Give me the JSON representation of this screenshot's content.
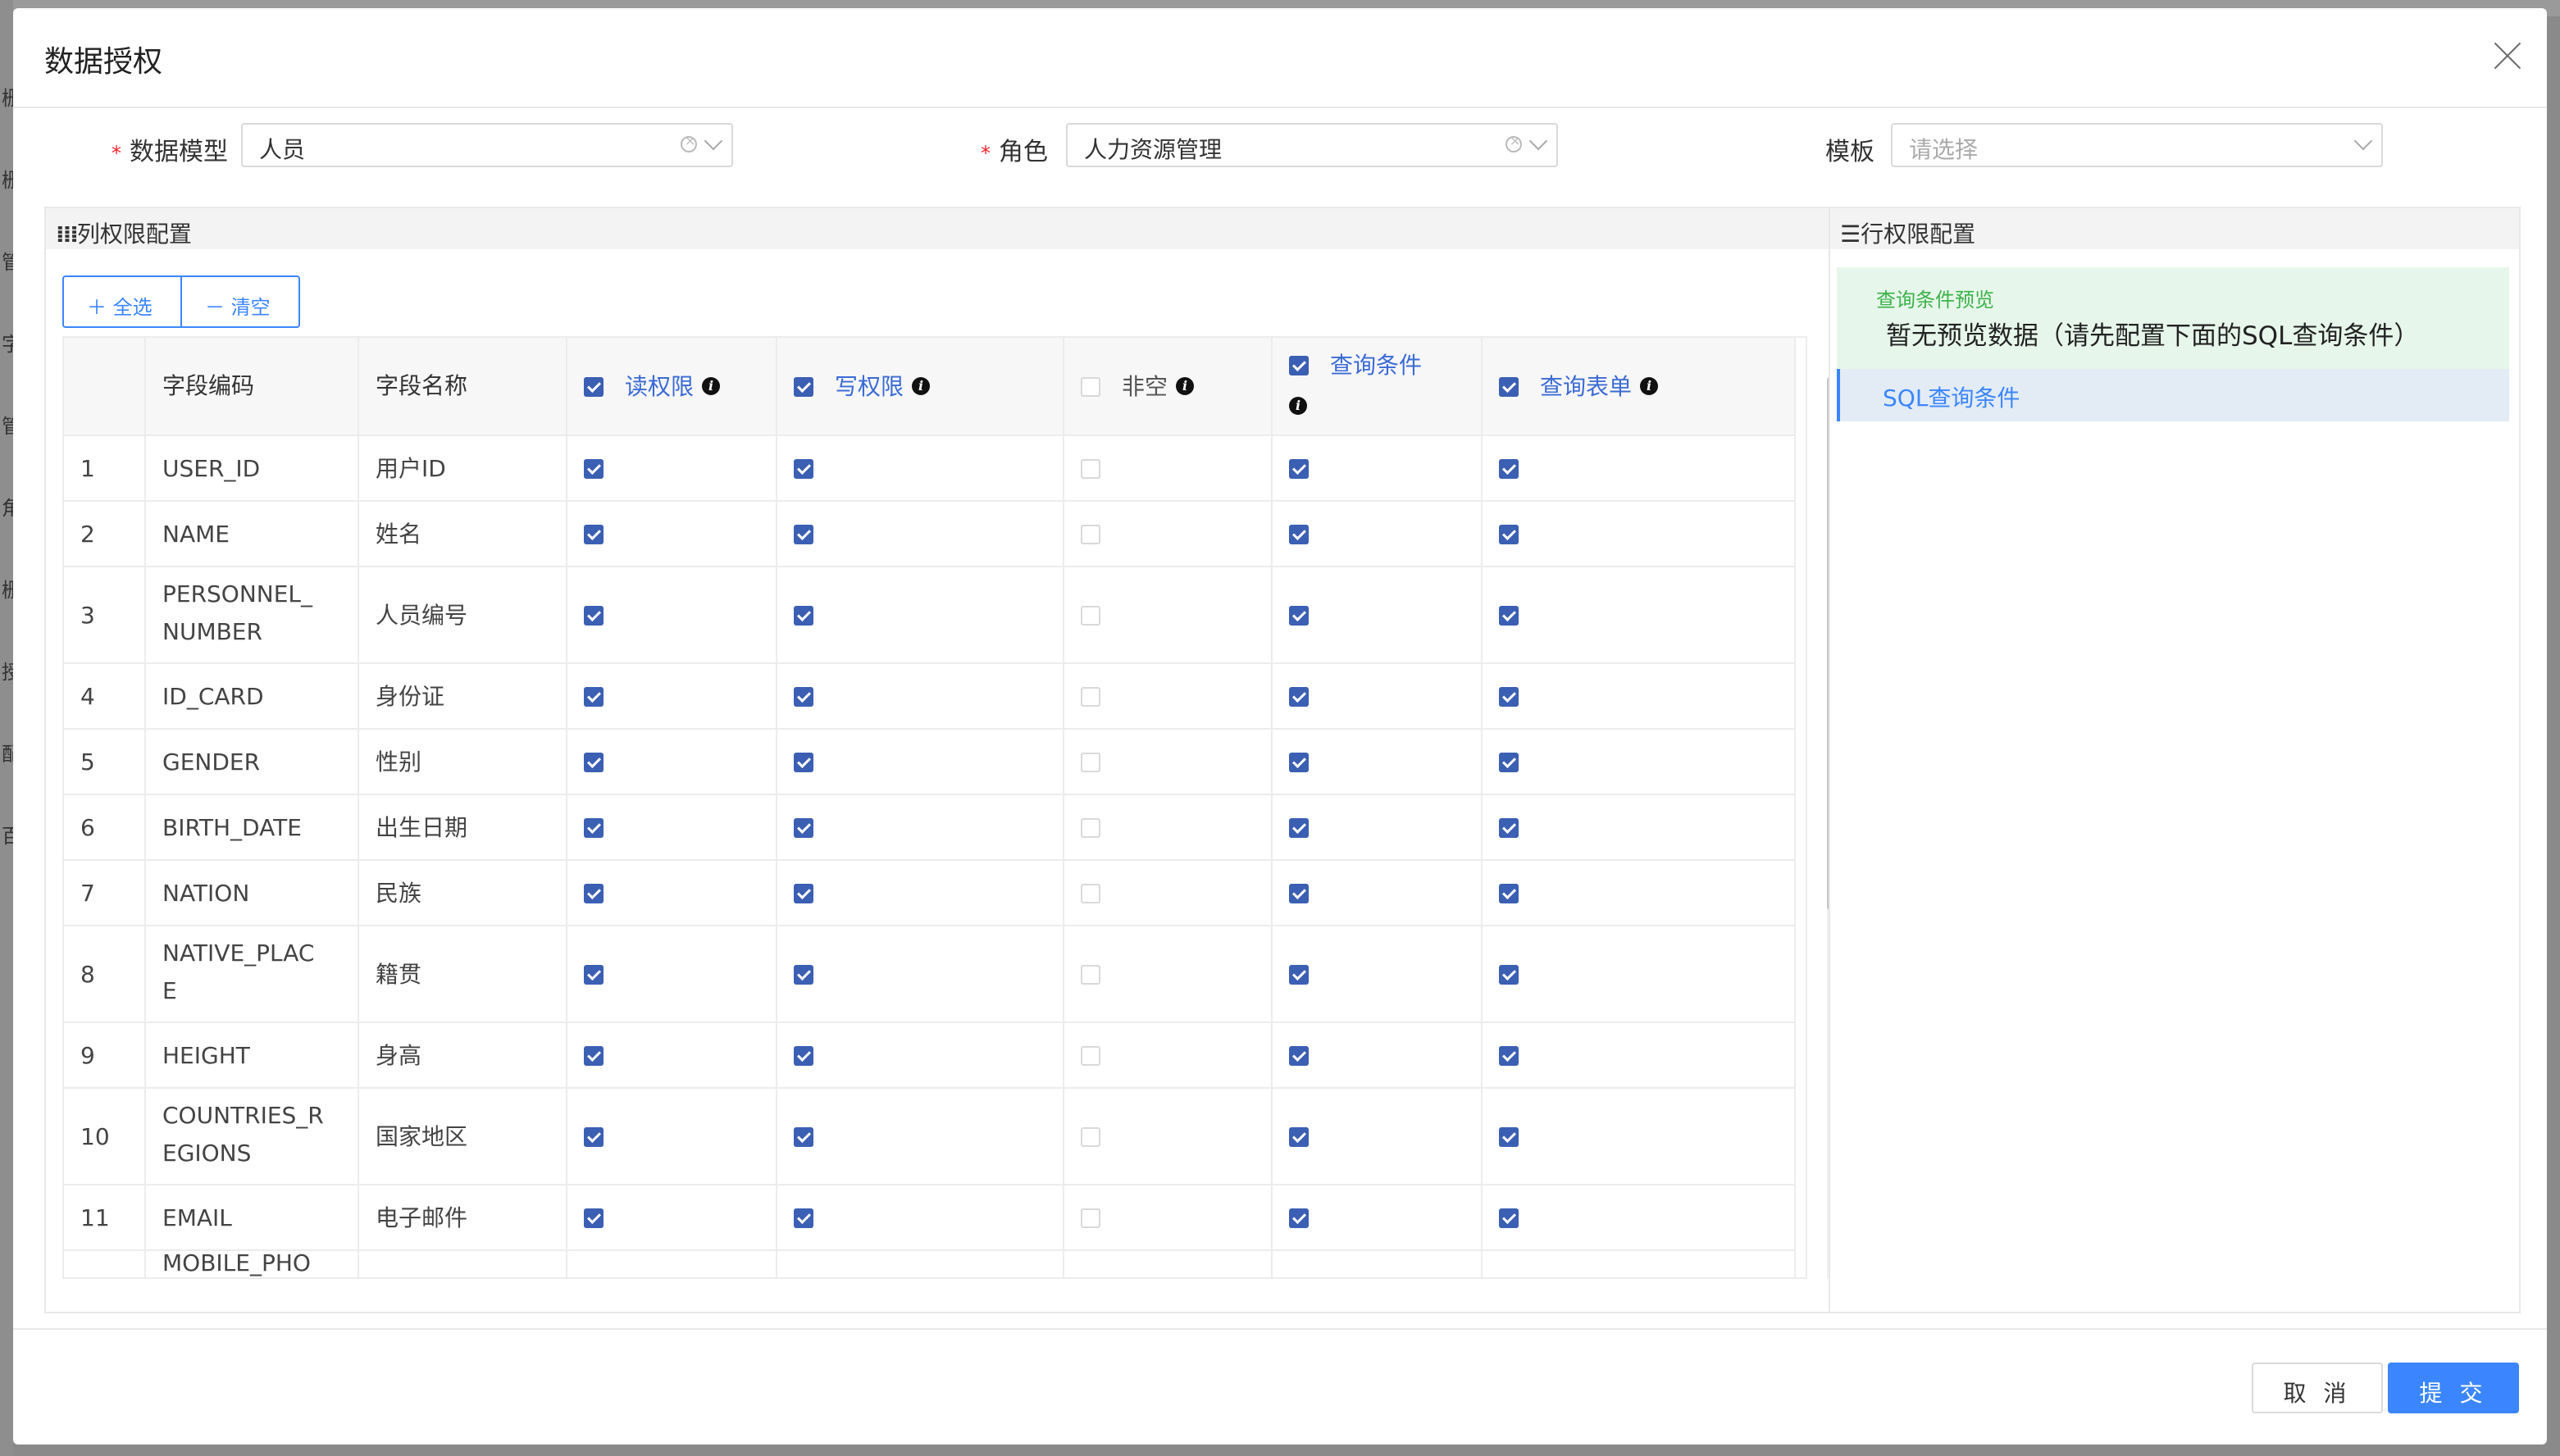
{
  "modal": {
    "title": "数据授权",
    "fields": {
      "data_model": {
        "label": "数据模型",
        "value": "人员"
      },
      "role": {
        "label": "角色",
        "value": "人力资源管理"
      },
      "template": {
        "label": "模板",
        "placeholder": "请选择"
      }
    }
  },
  "column_panel": {
    "title": "列权限配置",
    "select_all": "全选",
    "clear": "清空",
    "headers": {
      "code": "字段编码",
      "name": "字段名称",
      "read": {
        "label": "读权限",
        "checked": true
      },
      "write": {
        "label": "写权限",
        "checked": true
      },
      "not_null": {
        "label": "非空",
        "checked": false
      },
      "query": {
        "label": "查询条件",
        "checked": true
      },
      "query_form": {
        "label": "查询表单",
        "checked": true
      }
    },
    "rows": [
      {
        "index": "1",
        "code_lines": [
          "USER_ID"
        ],
        "name": "用户ID",
        "read": true,
        "write": true,
        "not_null": false,
        "query": true,
        "query_form": true
      },
      {
        "index": "2",
        "code_lines": [
          "NAME"
        ],
        "name": "姓名",
        "read": true,
        "write": true,
        "not_null": false,
        "query": true,
        "query_form": true
      },
      {
        "index": "3",
        "code_lines": [
          "PERSONNEL_",
          "NUMBER"
        ],
        "name": "人员编号",
        "read": true,
        "write": true,
        "not_null": false,
        "query": true,
        "query_form": true
      },
      {
        "index": "4",
        "code_lines": [
          "ID_CARD"
        ],
        "name": "身份证",
        "read": true,
        "write": true,
        "not_null": false,
        "query": true,
        "query_form": true
      },
      {
        "index": "5",
        "code_lines": [
          "GENDER"
        ],
        "name": "性别",
        "read": true,
        "write": true,
        "not_null": false,
        "query": true,
        "query_form": true
      },
      {
        "index": "6",
        "code_lines": [
          "BIRTH_DATE"
        ],
        "name": "出生日期",
        "read": true,
        "write": true,
        "not_null": false,
        "query": true,
        "query_form": true
      },
      {
        "index": "7",
        "code_lines": [
          "NATION"
        ],
        "name": "民族",
        "read": true,
        "write": true,
        "not_null": false,
        "query": true,
        "query_form": true
      },
      {
        "index": "8",
        "code_lines": [
          "NATIVE_PLAC",
          "E"
        ],
        "name": "籍贯",
        "read": true,
        "write": true,
        "not_null": false,
        "query": true,
        "query_form": true
      },
      {
        "index": "9",
        "code_lines": [
          "HEIGHT"
        ],
        "name": "身高",
        "read": true,
        "write": true,
        "not_null": false,
        "query": true,
        "query_form": true
      },
      {
        "index": "10",
        "code_lines": [
          "COUNTRIES_R",
          "EGIONS"
        ],
        "name": "国家地区",
        "read": true,
        "write": true,
        "not_null": false,
        "query": true,
        "query_form": true
      },
      {
        "index": "11",
        "code_lines": [
          "EMAIL"
        ],
        "name": "电子邮件",
        "read": true,
        "write": true,
        "not_null": false,
        "query": true,
        "query_form": true
      },
      {
        "index": "",
        "code_lines": [
          "MOBILE_PHO"
        ],
        "name": "",
        "read": false,
        "write": false,
        "not_null": false,
        "query": false,
        "query_form": false
      }
    ]
  },
  "row_panel": {
    "title": "行权限配置",
    "preview_label": "查询条件预览",
    "preview_text": "暂无预览数据（请先配置下面的SQL查询条件）",
    "sql_tab": "SQL查询条件"
  },
  "footer": {
    "cancel": "取 消",
    "submit": "提 交"
  },
  "background": {
    "side_glyphs": [
      "栅",
      "栅",
      "管",
      "字",
      "管",
      "角",
      "栅",
      "授",
      "配",
      "百"
    ]
  },
  "colors": {
    "primary": "#3b86ff",
    "checkbox": "#3b5fb3",
    "preview_bg": "#e7f6ea",
    "required": "#f5222d"
  }
}
